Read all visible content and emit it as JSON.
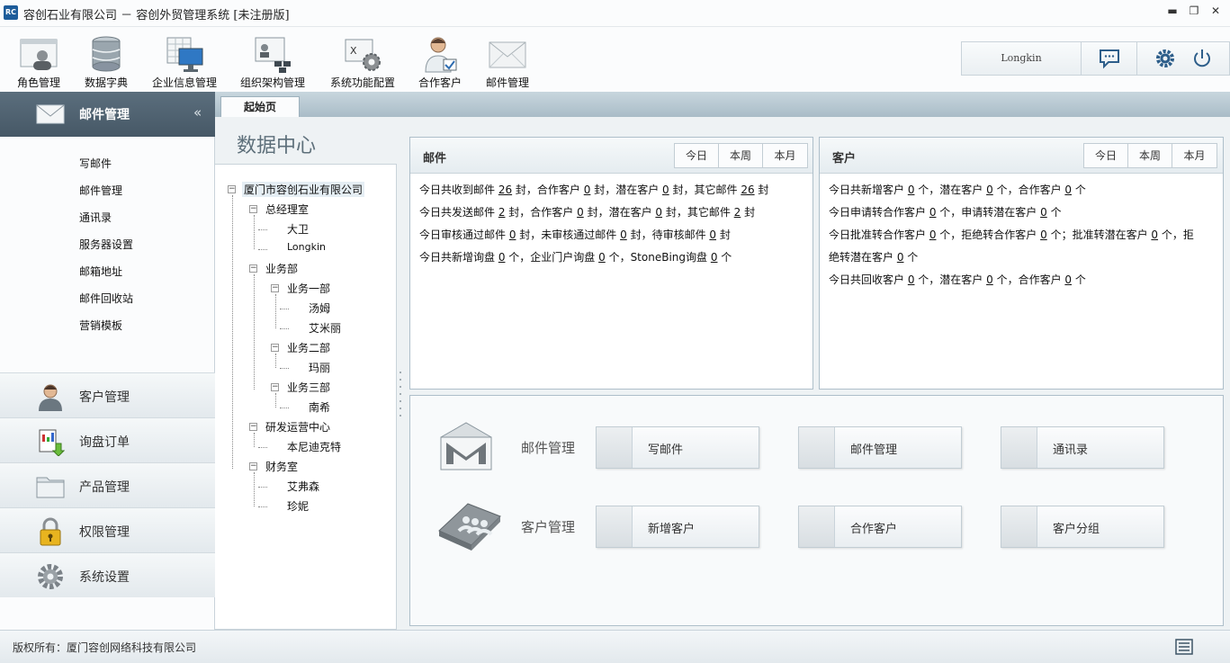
{
  "window": {
    "logo_text": "RC",
    "title": "容创石业有限公司 － 容创外贸管理系统 [未注册版]",
    "min": "▬",
    "max": "❐",
    "close": "✕"
  },
  "toolbar": {
    "items": [
      {
        "label": "角色管理",
        "icon": "role-icon"
      },
      {
        "label": "数据字典",
        "icon": "database-icon"
      },
      {
        "label": "企业信息管理",
        "icon": "enterprise-icon"
      },
      {
        "label": "组织架构管理",
        "icon": "org-chart-icon"
      },
      {
        "label": "系统功能配置",
        "icon": "config-icon"
      },
      {
        "label": "合作客户",
        "icon": "partner-icon"
      },
      {
        "label": "邮件管理",
        "icon": "mail-icon"
      }
    ],
    "user": "Longkin"
  },
  "sidebar": {
    "header": "邮件管理",
    "collapse": "«",
    "sub_items": [
      "写邮件",
      "邮件管理",
      "通讯录",
      "服务器设置",
      "邮箱地址",
      "邮件回收站",
      "营销模板"
    ],
    "groups": [
      {
        "label": "客户管理",
        "icon": "customer-icon"
      },
      {
        "label": "询盘订单",
        "icon": "inquiry-icon"
      },
      {
        "label": "产品管理",
        "icon": "folder-icon"
      },
      {
        "label": "权限管理",
        "icon": "lock-icon"
      },
      {
        "label": "系统设置",
        "icon": "gear-icon"
      }
    ]
  },
  "tabs": [
    {
      "label": "起始页"
    }
  ],
  "page_title": "数据中心",
  "tree": {
    "root": "厦门市容创石业有限公司",
    "nodes": {
      "gm": "总经理室",
      "gm_1": "大卫",
      "gm_2": "Longkin",
      "biz": "业务部",
      "biz1": "业务一部",
      "biz1_1": "汤姆",
      "biz1_2": "艾米丽",
      "biz2": "业务二部",
      "biz2_1": "玛丽",
      "biz3": "业务三部",
      "biz3_1": "南希",
      "rd": "研发运营中心",
      "rd_1": "本尼迪克特",
      "fin": "财务室",
      "fin_1": "艾弗森",
      "fin_2": "珍妮"
    }
  },
  "mail_panel": {
    "title": "邮件",
    "periods": [
      "今日",
      "本周",
      "本月"
    ],
    "lines": [
      {
        "p": [
          "今日共收到邮件 ",
          "26",
          " 封，合作客户 ",
          "0",
          " 封，潜在客户 ",
          "0",
          " 封，其它邮件 ",
          "26",
          " 封"
        ]
      },
      {
        "p": [
          "今日共发送邮件 ",
          "2",
          " 封，合作客户 ",
          "0",
          " 封，潜在客户 ",
          "0",
          " 封，其它邮件 ",
          "2",
          " 封"
        ]
      },
      {
        "p": [
          "今日审核通过邮件 ",
          "0",
          " 封，未审核通过邮件 ",
          "0",
          " 封，待审核邮件 ",
          "0",
          " 封"
        ]
      },
      {
        "p": [
          "今日共新增询盘 ",
          "0",
          " 个，企业门户询盘 ",
          "0",
          " 个，StoneBing询盘 ",
          "0",
          " 个"
        ]
      }
    ]
  },
  "customer_panel": {
    "title": "客户",
    "periods": [
      "今日",
      "本周",
      "本月"
    ],
    "lines": [
      {
        "p": [
          "今日共新增客户 ",
          "0",
          " 个，潜在客户 ",
          "0",
          " 个，合作客户 ",
          "0",
          " 个"
        ]
      },
      {
        "p": [
          "今日申请转合作客户 ",
          "0",
          " 个，申请转潜在客户 ",
          "0",
          " 个"
        ]
      },
      {
        "p": [
          "今日批准转合作客户 ",
          "0",
          " 个，拒绝转合作客户 ",
          "0",
          " 个；批准转潜在客户 ",
          "0",
          " 个，拒"
        ]
      },
      {
        "p": [
          "绝转潜在客户 ",
          "0",
          " 个"
        ]
      },
      {
        "p": [
          "今日共回收客户 ",
          "0",
          " 个，潜在客户 ",
          "0",
          " 个，合作客户 ",
          "0",
          " 个"
        ]
      }
    ]
  },
  "quick": {
    "mail_label": "邮件管理",
    "mail_buttons": [
      "写邮件",
      "邮件管理",
      "通讯录"
    ],
    "customer_label": "客户管理",
    "customer_buttons": [
      "新增客户",
      "合作客户",
      "客户分组"
    ]
  },
  "footer": {
    "copyright": "版权所有：厦门容创网络科技有限公司"
  }
}
